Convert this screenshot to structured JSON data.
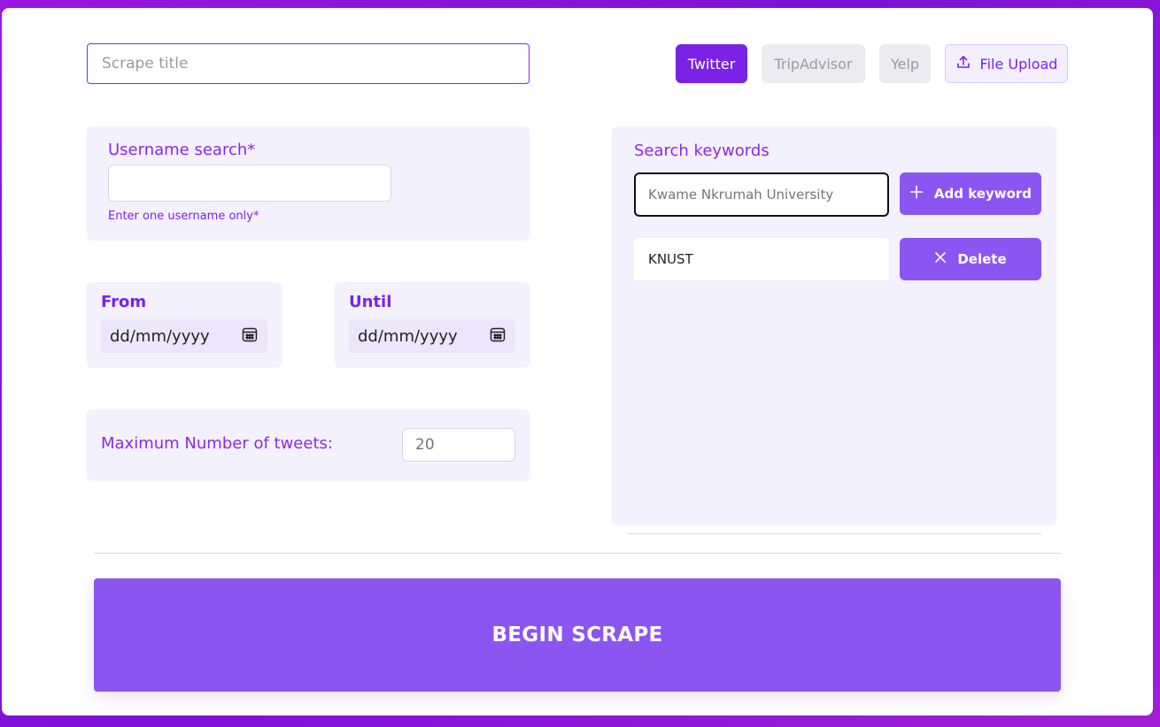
{
  "form": {
    "title_placeholder": "Scrape title",
    "title_value": ""
  },
  "sources": [
    {
      "label": "Twitter",
      "active": true
    },
    {
      "label": "TripAdvisor",
      "active": false
    },
    {
      "label": "Yelp",
      "active": false
    },
    {
      "label": "File Upload",
      "active": false
    }
  ],
  "username": {
    "label": "Username search*",
    "value": "",
    "hint": "Enter one username only*"
  },
  "dates": {
    "from_label": "From",
    "from_value": "dd/mm/yyyy",
    "until_label": "Until",
    "until_value": "dd/mm/yyyy"
  },
  "max_tweets": {
    "label": "Maximum Number of tweets:",
    "placeholder": "20"
  },
  "keywords": {
    "label": "Search keywords",
    "input_placeholder": "Kwame Nkrumah University",
    "add_label": "Add keyword",
    "items": [
      {
        "value": "KNUST",
        "delete_label": "Delete"
      }
    ]
  },
  "actions": {
    "begin_label": "BEGIN SCRAPE"
  },
  "colors": {
    "accent": "#7b22e6",
    "button": "#8b55f2",
    "panel": "#f4f1ff"
  }
}
